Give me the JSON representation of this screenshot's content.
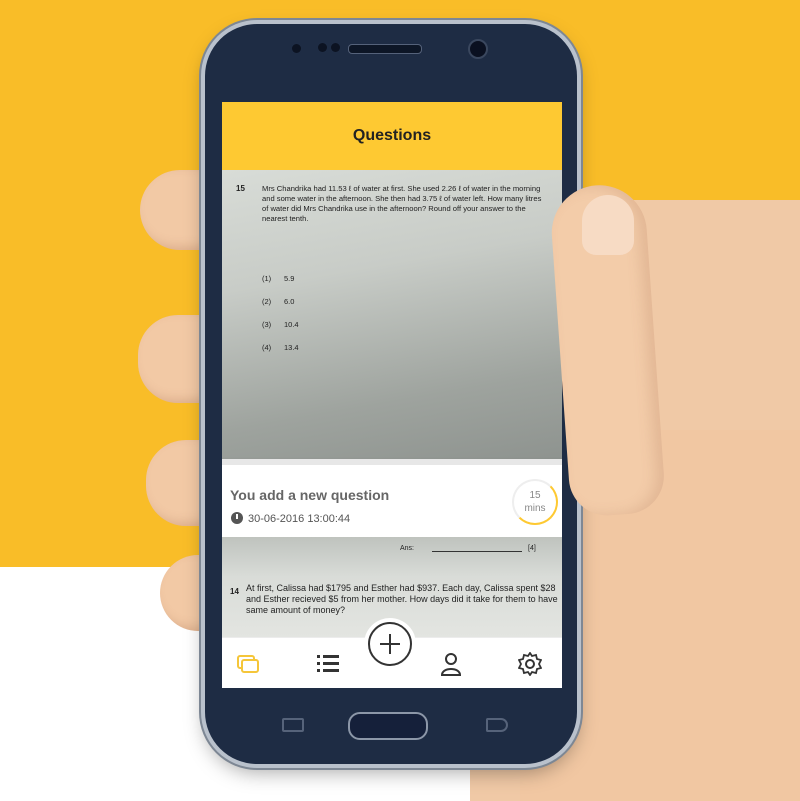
{
  "header": {
    "title": "Questions"
  },
  "question15": {
    "number": "15",
    "text": "Mrs Chandrika had 11.53 ℓ of water at first.   She used 2.26 ℓ of water in the morning and some water in the afternoon.   She then had 3.75 ℓ of water left.   How many litres of water did Mrs Chandrika use in the afternoon?   Round off your answer to the nearest tenth.",
    "options": [
      {
        "label": "(1)",
        "value": "5.9"
      },
      {
        "label": "(2)",
        "value": "6.0"
      },
      {
        "label": "(3)",
        "value": "10.4"
      },
      {
        "label": "(4)",
        "value": "13.4"
      }
    ]
  },
  "notification": {
    "title": "You add a new question",
    "timestamp": "30-06-2016 13:00:44",
    "timer_value": "15",
    "timer_unit": "mins",
    "timer_progress": 0.3,
    "accent_color": "#fec932"
  },
  "answer_line": {
    "label": "Ans:",
    "marks": "[4]"
  },
  "question14": {
    "number": "14",
    "text": "At first, Calissa had $1795 and Esther had $937. Each day, Calissa spent $28 and Esther recieved $5 from her mother. How days did it take for them to have same amount of money?"
  },
  "bottom_nav": {
    "items": [
      "cards-icon",
      "list-icon",
      "add-icon",
      "profile-icon",
      "settings-icon"
    ],
    "active": "cards-icon"
  },
  "colors": {
    "brand": "#fec932",
    "background_top": "#f9bd28",
    "phone_body": "#1e2c44"
  }
}
